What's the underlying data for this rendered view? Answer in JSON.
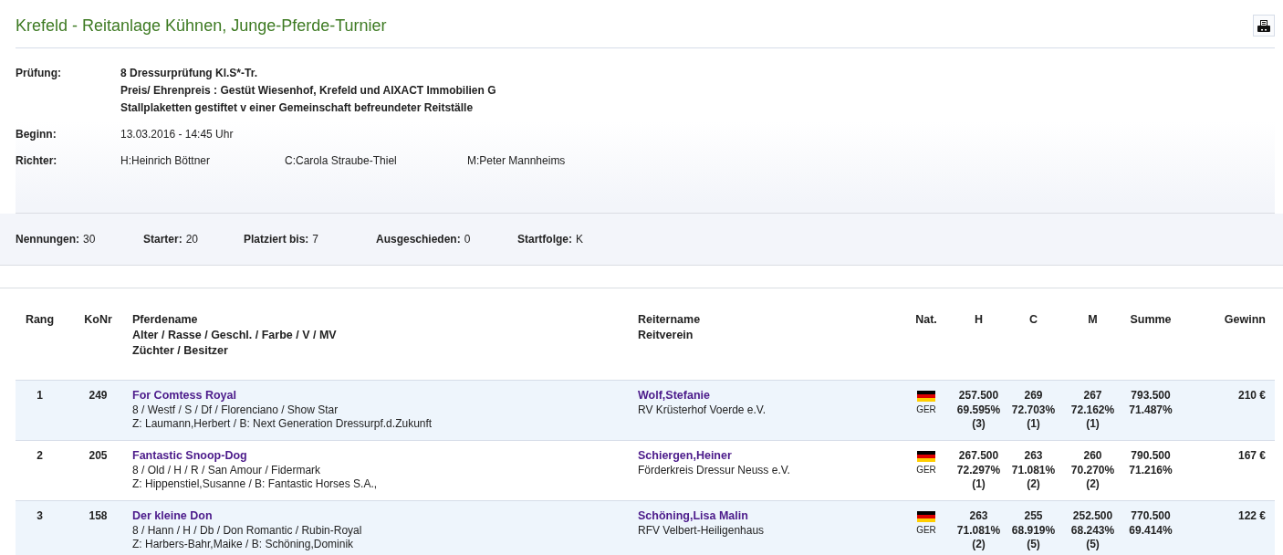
{
  "header": {
    "title": "Krefeld - Reitanlage Kühnen, Junge-Pferde-Turnier"
  },
  "info": {
    "pruefung": {
      "label": "Prüfung:",
      "lines": [
        "8 Dressurprüfung Kl.S*-Tr.",
        "Preis/ Ehrenpreis : Gestüt Wiesenhof, Krefeld und AIXACT Immobilien G",
        "Stallplaketten gestiftet v einer Gemeinschaft befreundeter Reitställe"
      ]
    },
    "beginn": {
      "label": "Beginn:",
      "value": "13.03.2016 - 14:45 Uhr"
    },
    "richter": {
      "label": "Richter:",
      "judges": [
        "H:Heinrich Böttner",
        "C:Carola Straube-Thiel",
        "M:Peter Mannheims"
      ]
    }
  },
  "stats": [
    {
      "label": "Nennungen:",
      "value": "30"
    },
    {
      "label": "Starter:",
      "value": "20"
    },
    {
      "label": "Platziert bis:",
      "value": "7"
    },
    {
      "label": "Ausgeschieden:",
      "value": "0"
    },
    {
      "label": "Startfolge:",
      "value": "K"
    }
  ],
  "table": {
    "columns": [
      {
        "lines": [
          "Rang"
        ]
      },
      {
        "lines": [
          "KoNr"
        ]
      },
      {
        "lines": [
          "Pferdename",
          "Alter / Rasse / Geschl. / Farbe / V / MV",
          "Züchter / Besitzer"
        ]
      },
      {
        "lines": [
          "Reitername",
          "Reitverein"
        ]
      },
      {
        "lines": [
          "Nat."
        ]
      },
      {
        "lines": [
          "H"
        ]
      },
      {
        "lines": [
          "C"
        ]
      },
      {
        "lines": [
          "M"
        ]
      },
      {
        "lines": [
          "Summe"
        ]
      },
      {
        "lines": [
          "Gewinn"
        ]
      }
    ],
    "rows": [
      {
        "rank": "1",
        "konr": "249",
        "horse": "For Comtess Royal",
        "horse_details": "8 / Westf / S / Df / Florenciano / Show Star",
        "breeder_owner": "Z: Laumann,Herbert / B: Next Generation Dressurpf.d.Zukunft",
        "rider": "Wolf,Stefanie",
        "club": "RV Krüsterhof Voerde e.V.",
        "nat": "GER",
        "judges": [
          {
            "points": "257.500",
            "percent": "69.595%",
            "placing": "(3)"
          },
          {
            "points": "269",
            "percent": "72.703%",
            "placing": "(1)"
          },
          {
            "points": "267",
            "percent": "72.162%",
            "placing": "(1)"
          }
        ],
        "total": {
          "points": "793.500",
          "percent": "71.487%"
        },
        "prize": "210 €"
      },
      {
        "rank": "2",
        "konr": "205",
        "horse": "Fantastic Snoop-Dog",
        "horse_details": "8 / Old / H / R / San Amour / Fidermark",
        "breeder_owner": "Z: Hippenstiel,Susanne / B: Fantastic Horses S.A.,",
        "rider": "Schiergen,Heiner",
        "club": "Förderkreis Dressur Neuss e.V.",
        "nat": "GER",
        "judges": [
          {
            "points": "267.500",
            "percent": "72.297%",
            "placing": "(1)"
          },
          {
            "points": "263",
            "percent": "71.081%",
            "placing": "(2)"
          },
          {
            "points": "260",
            "percent": "70.270%",
            "placing": "(2)"
          }
        ],
        "total": {
          "points": "790.500",
          "percent": "71.216%"
        },
        "prize": "167 €"
      },
      {
        "rank": "3",
        "konr": "158",
        "horse": "Der kleine Don",
        "horse_details": "8 / Hann / H / Db / Don Romantic / Rubin-Royal",
        "breeder_owner": "Z: Harbers-Bahr,Maike / B: Schöning,Dominik",
        "rider": "Schöning,Lisa Malin",
        "club": "RFV Velbert-Heiligenhaus",
        "nat": "GER",
        "judges": [
          {
            "points": "263",
            "percent": "71.081%",
            "placing": "(2)"
          },
          {
            "points": "255",
            "percent": "68.919%",
            "placing": "(5)"
          },
          {
            "points": "252.500",
            "percent": "68.243%",
            "placing": "(5)"
          }
        ],
        "total": {
          "points": "770.500",
          "percent": "69.414%"
        },
        "prize": "122 €"
      }
    ]
  }
}
